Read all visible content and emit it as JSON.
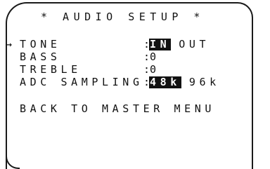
{
  "screen": {
    "title": "* AUDIO SETUP *"
  },
  "menu": {
    "cursor_glyph": "→",
    "tone": {
      "label": "TONE",
      "separator": ":",
      "options": [
        "IN",
        "OUT"
      ],
      "selected": "IN"
    },
    "bass": {
      "label": "BASS",
      "separator": ":",
      "value": "0"
    },
    "treble": {
      "label": "TREBLE",
      "separator": ":",
      "value": "0"
    },
    "adc_sampling": {
      "label": "ADC SAMPLING",
      "separator": ":",
      "options": [
        "48k",
        "96k"
      ],
      "selected": "48k"
    },
    "back": {
      "label": "BACK TO MASTER MENU"
    }
  },
  "colors": {
    "text": "#111111",
    "highlight_bg": "#111111",
    "highlight_text": "#ffffff",
    "background": "#ffffff"
  }
}
